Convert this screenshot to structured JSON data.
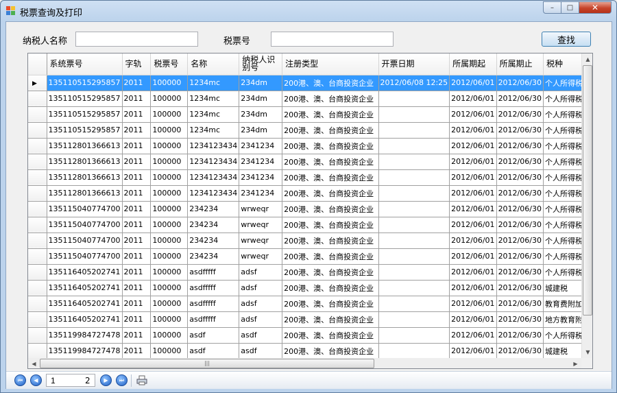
{
  "window": {
    "title": "税票查询及打印",
    "min_glyph": "–",
    "max_glyph": "□",
    "close_glyph": "✕"
  },
  "search": {
    "taxpayer_name_label": "纳税人名称",
    "taxpayer_name_value": "",
    "tax_ticket_label": "税票号",
    "tax_ticket_value": "",
    "search_button": "查找"
  },
  "grid": {
    "columns": [
      "系统票号",
      "字轨",
      "税票号",
      "名称",
      "纳税人识别号",
      "注册类型",
      "开票日期",
      "所属期起",
      "所属期止",
      "税种"
    ],
    "rows": [
      [
        "135110515295857",
        "2011",
        "100000",
        "1234mc",
        "234dm",
        "200港、澳、台商投资企业",
        "2012/06/08 12:25",
        "2012/06/01",
        "2012/06/30",
        "个人所得税"
      ],
      [
        "135110515295857",
        "2011",
        "100000",
        "1234mc",
        "234dm",
        "200港、澳、台商投资企业",
        "",
        "2012/06/01",
        "2012/06/30",
        "个人所得税"
      ],
      [
        "135110515295857",
        "2011",
        "100000",
        "1234mc",
        "234dm",
        "200港、澳、台商投资企业",
        "",
        "2012/06/01",
        "2012/06/30",
        "个人所得税"
      ],
      [
        "135110515295857",
        "2011",
        "100000",
        "1234mc",
        "234dm",
        "200港、澳、台商投资企业",
        "",
        "2012/06/01",
        "2012/06/30",
        "个人所得税"
      ],
      [
        "135112801366613",
        "2011",
        "100000",
        "1234123434",
        "2341234",
        "200港、澳、台商投资企业",
        "",
        "2012/06/01",
        "2012/06/30",
        "个人所得税"
      ],
      [
        "135112801366613",
        "2011",
        "100000",
        "1234123434",
        "2341234",
        "200港、澳、台商投资企业",
        "",
        "2012/06/01",
        "2012/06/30",
        "个人所得税"
      ],
      [
        "135112801366613",
        "2011",
        "100000",
        "1234123434",
        "2341234",
        "200港、澳、台商投资企业",
        "",
        "2012/06/01",
        "2012/06/30",
        "个人所得税"
      ],
      [
        "135112801366613",
        "2011",
        "100000",
        "1234123434",
        "2341234",
        "200港、澳、台商投资企业",
        "",
        "2012/06/01",
        "2012/06/30",
        "个人所得税"
      ],
      [
        "135115040774700",
        "2011",
        "100000",
        "234234",
        "wrweqr",
        "200港、澳、台商投资企业",
        "",
        "2012/06/01",
        "2012/06/30",
        "个人所得税"
      ],
      [
        "135115040774700",
        "2011",
        "100000",
        "234234",
        "wrweqr",
        "200港、澳、台商投资企业",
        "",
        "2012/06/01",
        "2012/06/30",
        "个人所得税"
      ],
      [
        "135115040774700",
        "2011",
        "100000",
        "234234",
        "wrweqr",
        "200港、澳、台商投资企业",
        "",
        "2012/06/01",
        "2012/06/30",
        "个人所得税"
      ],
      [
        "135115040774700",
        "2011",
        "100000",
        "234234",
        "wrweqr",
        "200港、澳、台商投资企业",
        "",
        "2012/06/01",
        "2012/06/30",
        "个人所得税"
      ],
      [
        "135116405202741",
        "2011",
        "100000",
        "asdfffff",
        "adsf",
        "200港、澳、台商投资企业",
        "",
        "2012/06/01",
        "2012/06/30",
        "个人所得税"
      ],
      [
        "135116405202741",
        "2011",
        "100000",
        "asdfffff",
        "adsf",
        "200港、澳、台商投资企业",
        "",
        "2012/06/01",
        "2012/06/30",
        "城建税"
      ],
      [
        "135116405202741",
        "2011",
        "100000",
        "asdfffff",
        "adsf",
        "200港、澳、台商投资企业",
        "",
        "2012/06/01",
        "2012/06/30",
        "教育费附加"
      ],
      [
        "135116405202741",
        "2011",
        "100000",
        "asdfffff",
        "adsf",
        "200港、澳、台商投资企业",
        "",
        "2012/06/01",
        "2012/06/30",
        "地方教育附加"
      ],
      [
        "135119984727478",
        "2011",
        "100000",
        "asdf",
        "asdf",
        "200港、澳、台商投资企业",
        "",
        "2012/06/01",
        "2012/06/30",
        "个人所得税"
      ],
      [
        "135119984727478",
        "2011",
        "100000",
        "asdf",
        "asdf",
        "200港、澳、台商投资企业",
        "",
        "2012/06/01",
        "2012/06/30",
        "城建税"
      ]
    ],
    "selected_row": 0
  },
  "pager": {
    "current_page": "1",
    "total_pages": "2"
  }
}
